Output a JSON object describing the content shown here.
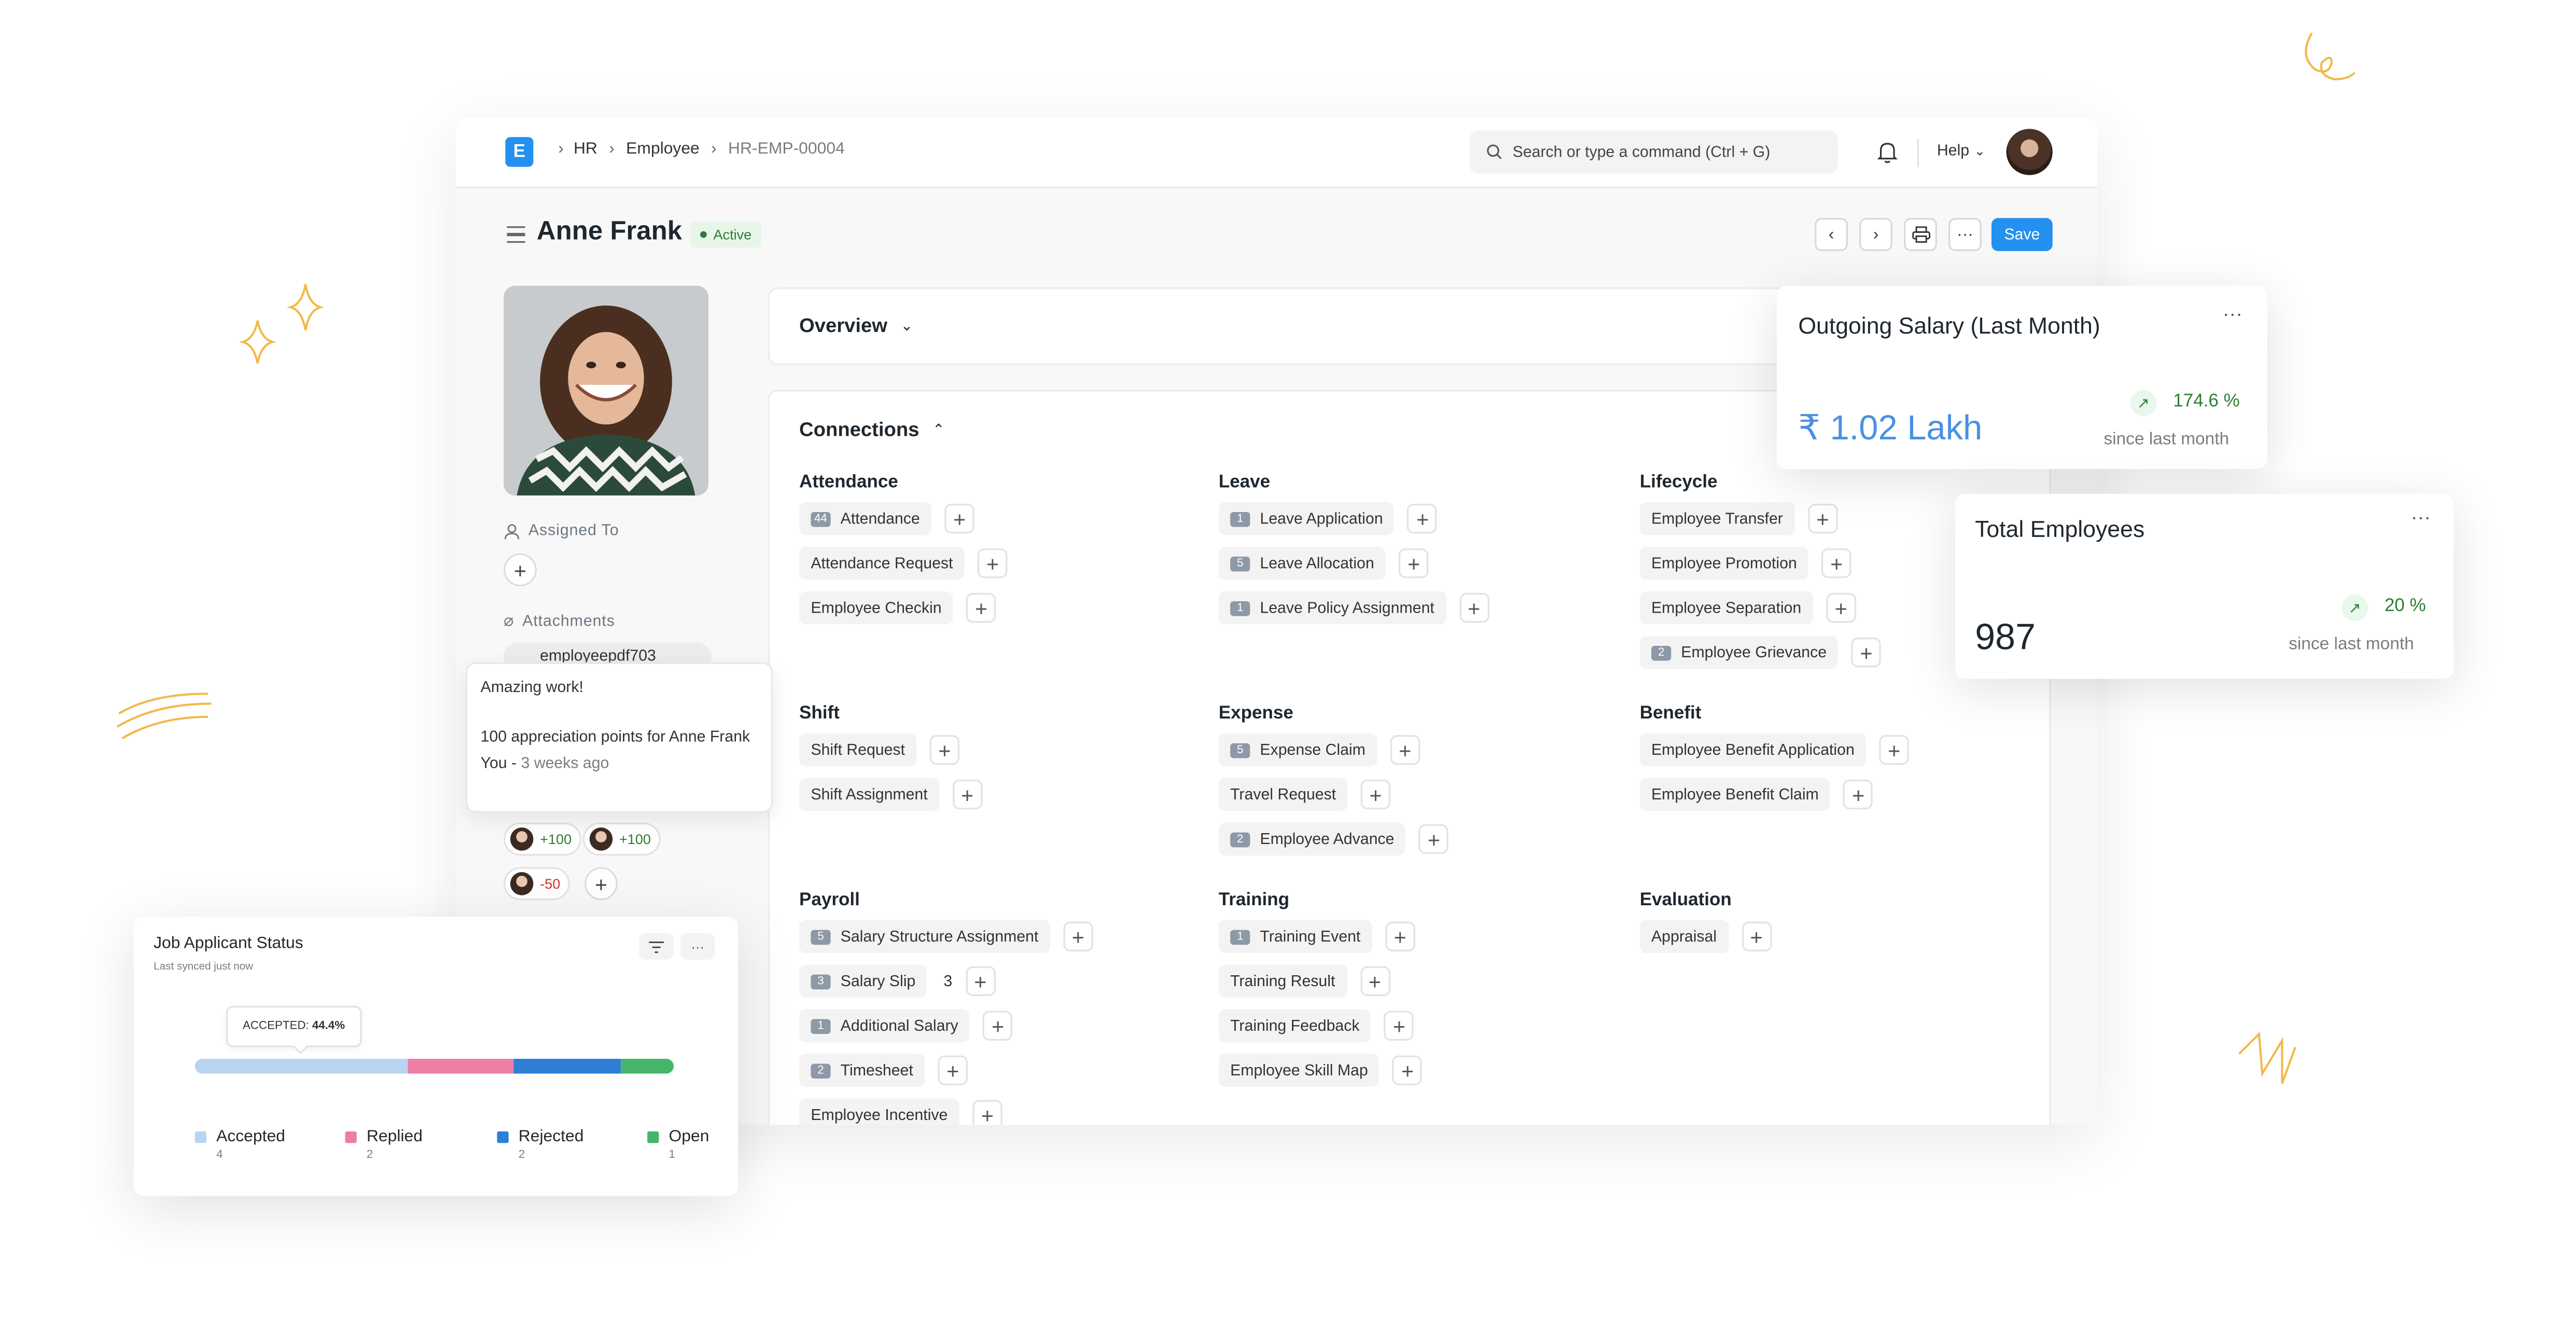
{
  "navbar": {
    "logo_letter": "E",
    "breadcrumbs": [
      "HR",
      "Employee",
      "HR-EMP-00004"
    ],
    "search_placeholder": "Search or type a command (Ctrl + G)",
    "help_label": "Help"
  },
  "header": {
    "title": "Anne Frank",
    "status": "Active",
    "save_label": "Save"
  },
  "sidebar": {
    "assigned_to_label": "Assigned To",
    "attachments_label": "Attachments",
    "attachment_name": "employeepdf703"
  },
  "popover": {
    "title": "Amazing work!",
    "body": "100 appreciation points for Anne Frank",
    "author": "You",
    "time": "3 weeks ago"
  },
  "kudos": [
    "+100",
    "+100",
    "-50"
  ],
  "overview": {
    "label": "Overview"
  },
  "connections": {
    "label": "Connections",
    "groups": [
      {
        "title": "Attendance",
        "items": [
          {
            "count": "44",
            "label": "Attendance"
          },
          {
            "count": "",
            "label": "Attendance Request"
          },
          {
            "count": "",
            "label": "Employee Checkin"
          }
        ]
      },
      {
        "title": "Leave",
        "items": [
          {
            "count": "1",
            "label": "Leave Application"
          },
          {
            "count": "5",
            "label": "Leave Allocation"
          },
          {
            "count": "1",
            "label": "Leave Policy Assignment"
          }
        ]
      },
      {
        "title": "Lifecycle",
        "items": [
          {
            "count": "",
            "label": "Employee Transfer"
          },
          {
            "count": "",
            "label": "Employee Promotion"
          },
          {
            "count": "",
            "label": "Employee Separation"
          },
          {
            "count": "2",
            "label": "Employee Grievance"
          }
        ]
      },
      {
        "title": "Shift",
        "items": [
          {
            "count": "",
            "label": "Shift Request"
          },
          {
            "count": "",
            "label": "Shift Assignment"
          }
        ]
      },
      {
        "title": "Expense",
        "items": [
          {
            "count": "5",
            "label": "Expense Claim"
          },
          {
            "count": "",
            "label": "Travel Request"
          },
          {
            "count": "2",
            "label": "Employee Advance"
          }
        ]
      },
      {
        "title": "Benefit",
        "items": [
          {
            "count": "",
            "label": "Employee Benefit Application"
          },
          {
            "count": "",
            "label": "Employee Benefit Claim"
          }
        ]
      },
      {
        "title": "Payroll",
        "items": [
          {
            "count": "5",
            "label": "Salary Structure Assignment"
          },
          {
            "count": "3",
            "label": "Salary Slip",
            "extra": "3"
          },
          {
            "count": "1",
            "label": "Additional Salary"
          },
          {
            "count": "2",
            "label": "Timesheet"
          },
          {
            "count": "",
            "label": "Employee Incentive"
          }
        ]
      },
      {
        "title": "Training",
        "items": [
          {
            "count": "1",
            "label": "Training Event"
          },
          {
            "count": "",
            "label": "Training Result"
          },
          {
            "count": "",
            "label": "Training Feedback"
          },
          {
            "count": "",
            "label": "Employee Skill Map"
          }
        ]
      },
      {
        "title": "Evaluation",
        "items": [
          {
            "count": "",
            "label": "Appraisal"
          }
        ]
      }
    ]
  },
  "salary_card": {
    "title": "Outgoing Salary (Last Month)",
    "value": "₹ 1.02 Lakh",
    "change": "174.6 %",
    "since": "since last month"
  },
  "employees_card": {
    "title": "Total Employees",
    "value": "987",
    "change": "20 %",
    "since": "since last month"
  },
  "job_card": {
    "title": "Job Applicant Status",
    "subtitle": "Last synced just now",
    "tooltip_label": "ACCEPTED:",
    "tooltip_value": "44.4%",
    "legend": [
      {
        "label": "Accepted",
        "count": "4",
        "color": "#b9d4ef"
      },
      {
        "label": "Replied",
        "count": "2",
        "color": "#ee7ea6"
      },
      {
        "label": "Rejected",
        "count": "2",
        "color": "#2f7fd6"
      },
      {
        "label": "Open",
        "count": "1",
        "color": "#46b56a"
      }
    ]
  },
  "colors": {
    "accent": "#2490ef",
    "success": "#2e7d32",
    "doodle": "#f2b94a"
  }
}
